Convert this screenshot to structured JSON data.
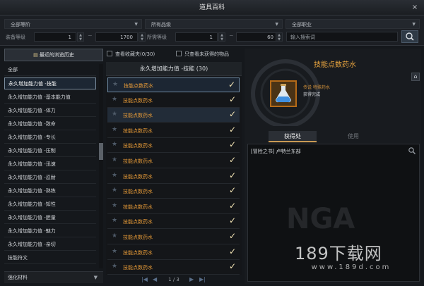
{
  "window": {
    "title": "道具百科",
    "close_label": "×"
  },
  "filters": {
    "region": "全部等阶",
    "grade": "所有品级",
    "job": "全部职业",
    "equip_level_label": "装备等级",
    "equip_level_min": "1",
    "equip_level_max": "1700",
    "use_level_label": "所需等级",
    "use_level_min": "1",
    "use_level_max": "60",
    "search_placeholder": "输入搜索词"
  },
  "left": {
    "recent_label": "最近的浏览历史",
    "categories": [
      "全部",
      "永久增加能力值 -技能",
      "永久增加能力值 -基本能力值",
      "永久增加能力值 -体力",
      "永久增加能力值 -致命",
      "永久增加能力值 -专长",
      "永久增加能力值 -压制",
      "永久增加能力值 -迅速",
      "永久增加能力值 -忍耐",
      "永久增加能力值 -熟练",
      "永久增加能力值 -知性",
      "永久增加能力值 -胆量",
      "永久增加能力值 -魅力",
      "永久增加能力值 -亲切",
      "技能符文"
    ],
    "footer_label": "强化材料"
  },
  "checks": {
    "favorites": "查看收藏夹(0/30)",
    "unowned": "只查看未获得的物品"
  },
  "list": {
    "header": "永久增加能力值 -技能 (30)",
    "item_name": "技能点数药水",
    "rows": 13,
    "page": "1 / 3"
  },
  "detail": {
    "title": "技能点数药水",
    "grade": "传说 特殊药水",
    "status": "获得完成",
    "tab_source": "获得处",
    "tab_use": "使用",
    "source": "[冒险之书] 卢特兰东部"
  },
  "watermark": {
    "nga": "NGA",
    "site": "189下载网",
    "url": "www.189d.com"
  }
}
